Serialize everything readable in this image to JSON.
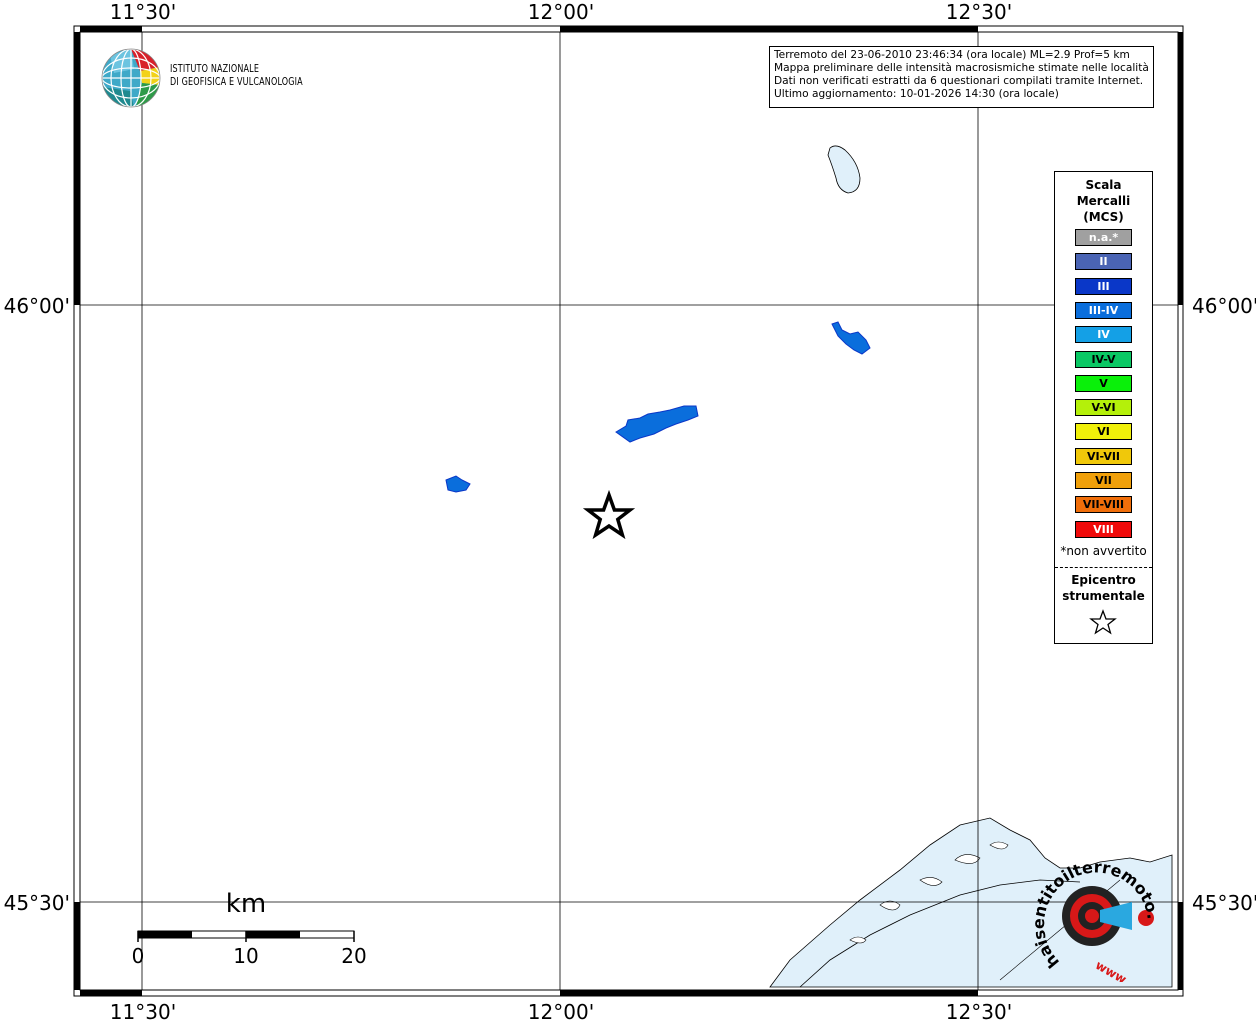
{
  "map": {
    "coords": {
      "top": [
        "11°30'",
        "12°00'",
        "12°30'"
      ],
      "bottom": [
        "11°30'",
        "12°00'",
        "12°30'"
      ],
      "left": [
        "46°00'",
        "45°30'"
      ],
      "right": [
        "46°00'",
        "45°30'"
      ]
    },
    "colors": {
      "sea": "#e0f0fa",
      "coast": "#000000",
      "grid": "#000000"
    }
  },
  "info": {
    "lines": [
      "Terremoto del 23-06-2010 23:46:34 (ora locale) ML=2.9 Prof=5 km",
      "Mappa preliminare delle intensità macrosismiche stimate nelle località",
      "Dati non verificati estratti da 6 questionari compilati tramite Internet.",
      "Ultimo aggiornamento: 10-01-2026 14:30 (ora locale)"
    ]
  },
  "logo": {
    "line1": "ISTITUTO NAZIONALE",
    "line2": "DI GEOFISICA E VULCANOLOGIA"
  },
  "legend": {
    "title_lines": [
      "Scala",
      "Mercalli",
      "(MCS)"
    ],
    "levels": [
      {
        "label": "n.a.*",
        "color": "#a0a0a0",
        "text": "#ffffff"
      },
      {
        "label": "II",
        "color": "#4a64b4",
        "text": "#ffffff"
      },
      {
        "label": "III",
        "color": "#0a37c8",
        "text": "#ffffff"
      },
      {
        "label": "III-IV",
        "color": "#0a6edc",
        "text": "#ffffff"
      },
      {
        "label": "IV",
        "color": "#14a0e6",
        "text": "#ffffff"
      },
      {
        "label": "IV-V",
        "color": "#0ac864",
        "text": "#000000"
      },
      {
        "label": "V",
        "color": "#0af00a",
        "text": "#000000"
      },
      {
        "label": "V-VI",
        "color": "#b4f00a",
        "text": "#000000"
      },
      {
        "label": "VI",
        "color": "#f0f00a",
        "text": "#000000"
      },
      {
        "label": "VI-VII",
        "color": "#f0c80a",
        "text": "#000000"
      },
      {
        "label": "VII",
        "color": "#f0a00a",
        "text": "#000000"
      },
      {
        "label": "VII-VIII",
        "color": "#f06e0a",
        "text": "#000000"
      },
      {
        "label": "VIII",
        "color": "#f00a0a",
        "text": "#ffffff"
      }
    ],
    "note": "*non avvertito",
    "epicenter_lines": [
      "Epicentro",
      "strumentale"
    ]
  },
  "scalebar": {
    "unit": "km",
    "labels": [
      "0",
      "10",
      "20"
    ]
  },
  "watermark": {
    "text": "haisentitoilterremoto.it",
    "prefix": "www.",
    "colors": {
      "red": "#d81818",
      "blue": "#2aa8e0"
    }
  }
}
